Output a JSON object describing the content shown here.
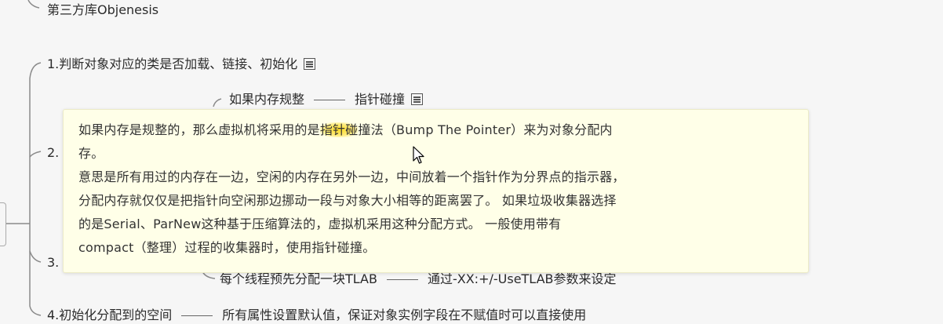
{
  "mindmap": {
    "top_node": "第三方库Objenesis",
    "node1": "1.判断对象对应的类是否加载、链接、初始化",
    "node2_partial": "2.",
    "node3_partial": "3.",
    "sub_memory_regular": "如果内存规整",
    "sub_pointer_bump": "指针碰撞",
    "sub_tlab": "每个线程预先分配一块TLAB",
    "sub_tlab_setting": "通过-XX:+/-UseTLAB参数来设定",
    "node4": "4.初始化分配到的空间",
    "node4_detail": "所有属性设置默认值，保证对象实例字段在不赋值时可以直接使用"
  },
  "tooltip": {
    "line1_before": "如果内存是规整的，那么虚拟机将采用的是",
    "line1_highlight": "指针碰",
    "line1_after": "撞法（Bump The Pointer）来为对象分配内",
    "line2": "存。",
    "line3": "意思是所有用过的内存在一边，空闲的内存在另外一边，中间放着一个指针作为分界点的指示器，",
    "line4": "分配内存就仅仅是把指针向空闲那边挪动一段与对象大小相等的距离罢了。 如果垃圾收集器选择",
    "line5": "的是Serial、ParNew这种基于压缩算法的，虚拟机采用这种分配方式。 一般使用带有",
    "line6": "compact（整理）过程的收集器时，使用指针碰撞。"
  },
  "icons": {
    "note": "note-icon",
    "cursor": "mouse-cursor-icon"
  }
}
